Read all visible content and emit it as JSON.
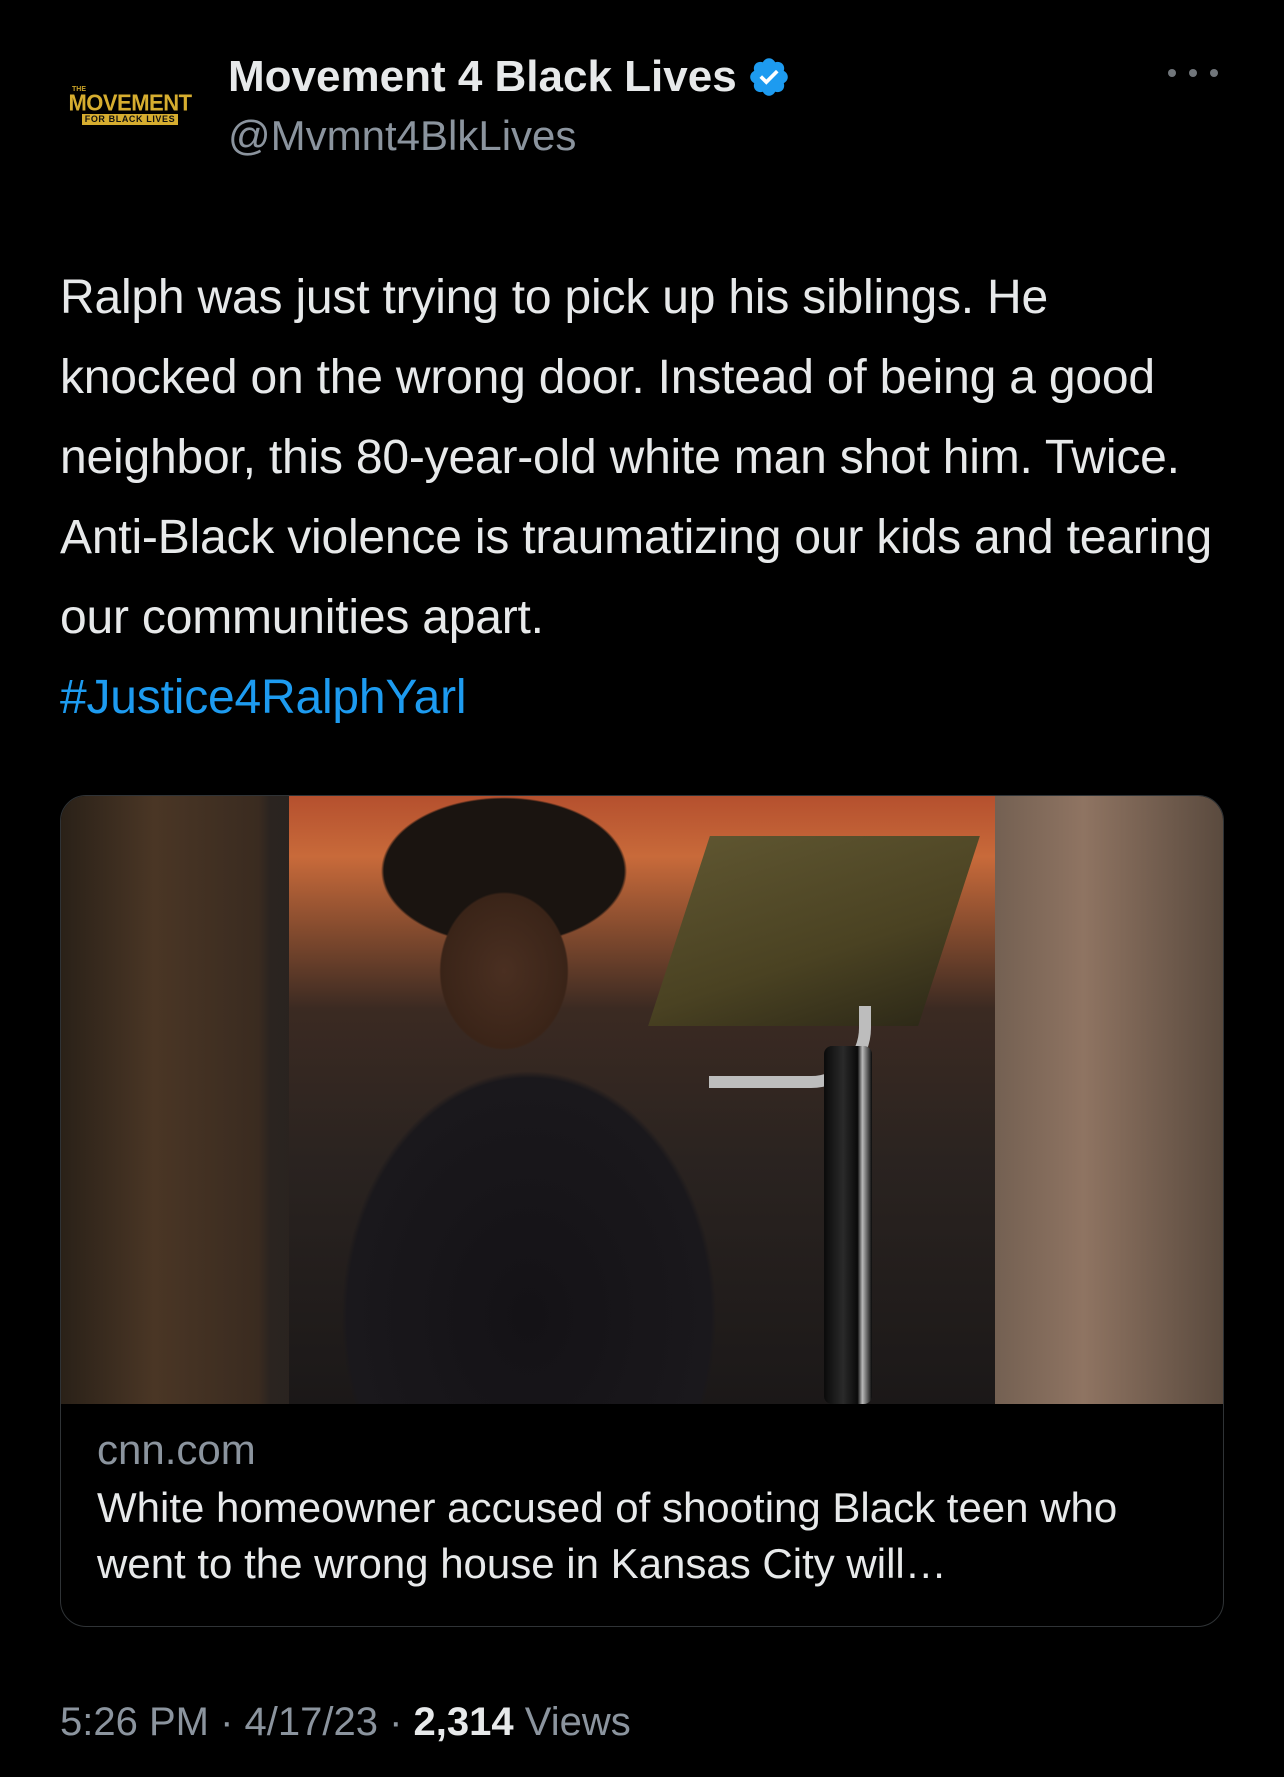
{
  "author": {
    "display_name": "Movement 4 Black Lives",
    "handle": "@Mvmnt4BlkLives",
    "avatar": {
      "small_text": "THE",
      "main_text": "MOVEMENT",
      "sub_text": "FOR BLACK LIVES"
    },
    "verified_icon": "verified-badge-icon"
  },
  "more_icon": "more-dots-icon",
  "tweet": {
    "text": "Ralph was just trying to pick up his siblings. He knocked on the wrong door. Instead of being a good neighbor, this 80-year-old white man shot him. Twice. Anti-Black violence is traumatizing our kids and tearing our communities apart.",
    "hashtag": "#Justice4RalphYarl"
  },
  "card": {
    "domain": "cnn.com",
    "title": "White homeowner accused of shooting Black teen who went to the wrong house in Kansas City will…"
  },
  "meta": {
    "time": "5:26 PM",
    "separator": " · ",
    "date": "4/17/23",
    "views_count": "2,314",
    "views_label": "Views"
  },
  "colors": {
    "background": "#000000",
    "text": "#e7e9ea",
    "muted": "#8b949e",
    "link": "#1d9bf0",
    "logo_gold": "#d6ad2f"
  }
}
